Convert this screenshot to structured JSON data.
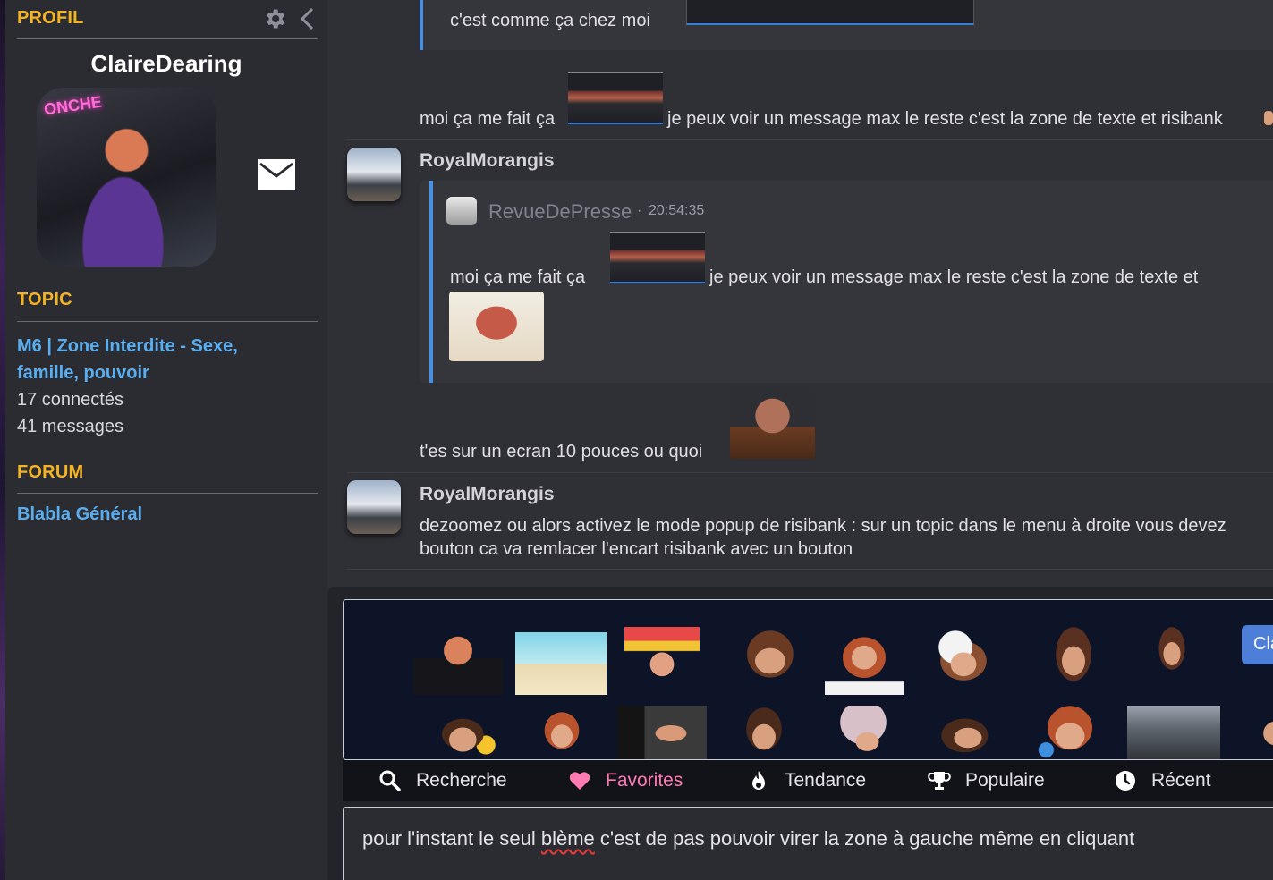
{
  "sidebar": {
    "profile_title": "PROFIL",
    "username": "ClaireDearing",
    "avatar_badge": "ONCHE",
    "topic_title": "TOPIC",
    "topic_name": "M6 | Zone Interdite - Sexe, famille, pouvoir",
    "connected": "17 connectés",
    "messages": "41 messages",
    "forum_title": "FORUM",
    "forum_name": "Blabla Général"
  },
  "chat": {
    "messages": [
      {
        "text": "c'est comme ça chez moi"
      },
      {
        "text": "moi ça me fait ça",
        "text_after": "je peux voir un message max le reste c'est la zone de texte et risibank"
      },
      {
        "author": "RoyalMorangis",
        "quote": {
          "author": "RevueDePresse",
          "separator": "·",
          "time": "20:54:35",
          "text": "moi ça me fait ça",
          "text_after": "je peux voir un message max le reste c'est la zone de texte et"
        },
        "text": "t'es sur un ecran 10 pouces ou quoi"
      },
      {
        "author": "RoyalMorangis",
        "text_line1": "dezoomez ou alors activez le mode popup de risibank : sur un topic dans le menu à droite vous devez",
        "text_line2": "bouton ca va remlacer l'encart risibank avec un bouton"
      }
    ]
  },
  "composer": {
    "risibank_button": "Clair",
    "tabs": [
      {
        "label": "Recherche",
        "icon": "search-icon"
      },
      {
        "label": "Favorites",
        "icon": "heart-icon"
      },
      {
        "label": "Tendance",
        "icon": "flame-icon"
      },
      {
        "label": "Populaire",
        "icon": "trophy-icon"
      },
      {
        "label": "Récent",
        "icon": "clock-icon"
      }
    ],
    "draft_before": "pour l'instant le seul ",
    "draft_misspelled": "blème",
    "draft_after": " c'est de pas pouvoir virer la zone à gauche même en cliquant"
  },
  "colors": {
    "section_title": "#f4b323",
    "link": "#5aaef0",
    "quote_bar": "#4a90e2",
    "favorites": "#ff7ab0",
    "risibank_bg": "#0e1428"
  }
}
